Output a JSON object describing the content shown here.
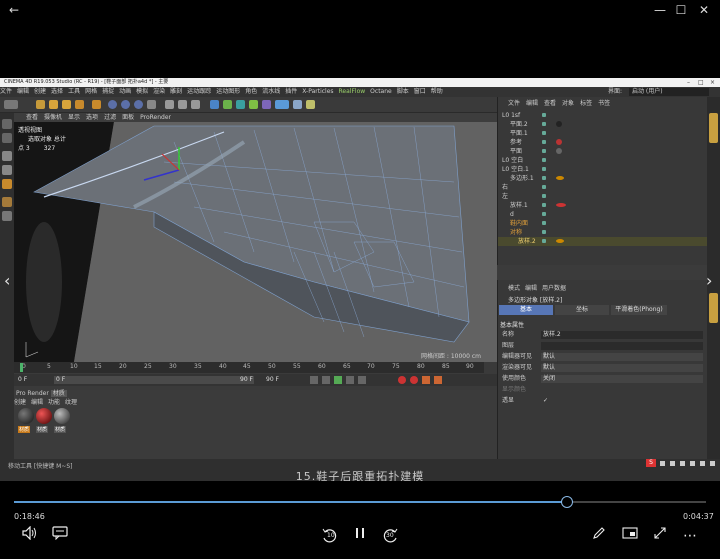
{
  "window_controls": {
    "back": "←",
    "minimize": "—",
    "maximize": "☐",
    "close": "✕"
  },
  "c4d": {
    "title": "CINEMA 4D R19.053 Studio (RC - R19) - [鞋子面部 拓扑a4d *] - 主要",
    "menu": [
      "文件",
      "编辑",
      "创建",
      "选择",
      "工具",
      "网格",
      "捕捉",
      "动画",
      "模拟",
      "渲染",
      "雕刻",
      "运动跟踪",
      "运动图形",
      "角色",
      "流水线",
      "插件",
      "X-Particles",
      "RealFlow",
      "Octane",
      "脚本",
      "窗口",
      "帮助"
    ],
    "layout_label": "界面:",
    "layout_value": "启动 (用户)",
    "viewport_menu": [
      "查看",
      "摄像机",
      "显示",
      "选项",
      "过滤",
      "面板",
      "ProRender"
    ],
    "hud": {
      "view_name": "透视视图",
      "selected_label": "选取对象 总计",
      "points_label": "点 3",
      "points_value": "327"
    },
    "grid_spacing": "网格间距 : 10000 cm",
    "ruler_ticks": [
      "0",
      "5",
      "10",
      "15",
      "20",
      "25",
      "30",
      "35",
      "40",
      "45",
      "50",
      "55",
      "60",
      "65",
      "70",
      "75",
      "80",
      "85",
      "90"
    ],
    "frame_start": "0 F",
    "frame_field": "0 F",
    "frame_end": "90 F",
    "frame_end2": "90 F",
    "material_menu": [
      "创建",
      "编辑",
      "功能",
      "纹理"
    ],
    "material_tabs": [
      "Pro Render",
      "材质"
    ],
    "materials": [
      "材质",
      "材质",
      "材质"
    ],
    "object_menu": [
      "文件",
      "编辑",
      "查看",
      "对象",
      "标签",
      "书签"
    ],
    "objects": [
      {
        "name": "L0 1sf"
      },
      {
        "name": "平面.2"
      },
      {
        "name": "平面.1"
      },
      {
        "name": "参考"
      },
      {
        "name": "平面"
      },
      {
        "name": "L0 空白"
      },
      {
        "name": "L0 空白.1"
      },
      {
        "name": "多边形.1"
      },
      {
        "name": "右"
      },
      {
        "name": "左"
      },
      {
        "name": "放样.1"
      },
      {
        "name": "d"
      },
      {
        "name": "鞋内面"
      },
      {
        "name": "对称"
      },
      {
        "name": "放样.2"
      }
    ],
    "attr_menu": [
      "模式",
      "编辑",
      "用户数据"
    ],
    "attr_title": "多边形对象 [放样.2]",
    "attr_tabs": [
      "基本",
      "坐标",
      "平滑着色(Phong)"
    ],
    "attr_section": "基本属性",
    "attr_rows": [
      {
        "label": "名称",
        "value": "放样.2"
      },
      {
        "label": "图层",
        "value": ""
      },
      {
        "label": "编辑器可见",
        "value": "默认"
      },
      {
        "label": "渲染器可见",
        "value": "默认"
      },
      {
        "label": "使用颜色",
        "value": "关闭"
      },
      {
        "label": "显示颜色",
        "value": ""
      },
      {
        "label": "透显",
        "value": "✓"
      }
    ],
    "status_text": "移动工具 [快捷键 M~S]",
    "tray_brand": "S"
  },
  "subtitle": "15.鞋子后跟重拓扑建模",
  "player": {
    "elapsed": "0:18:46",
    "remaining": "0:04:37",
    "progress": 0.799,
    "skip_back_label": "10",
    "skip_forward_label": "30",
    "colors": {
      "accent": "#5b9bd5",
      "track": "#444444"
    }
  },
  "icons": [
    "volume-icon",
    "captions-icon",
    "skip-back-10-icon",
    "pause-icon",
    "skip-forward-30-icon",
    "pen-icon",
    "mini-player-icon",
    "fullscreen-icon",
    "more-icon",
    "chevron-left-icon",
    "chevron-right-icon"
  ]
}
